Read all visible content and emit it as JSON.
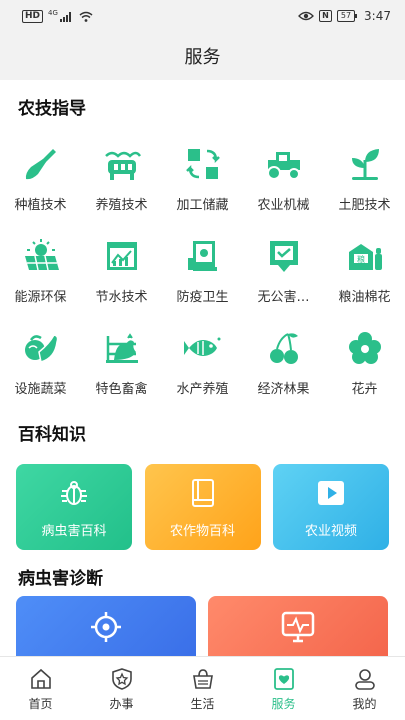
{
  "status_bar": {
    "hd": "HD",
    "network": "4G",
    "battery": "57",
    "time": "3:47"
  },
  "header": {
    "title": "服务"
  },
  "sections": {
    "tech": {
      "title": "农技指导"
    },
    "wiki": {
      "title": "百科知识"
    },
    "diagnosis": {
      "title": "病虫害诊断"
    }
  },
  "tech_items": [
    {
      "label": "种植技术",
      "icon": "shovel-sprout-icon"
    },
    {
      "label": "养殖技术",
      "icon": "livestock-icon"
    },
    {
      "label": "加工储藏",
      "icon": "processing-storage-icon"
    },
    {
      "label": "农业机械",
      "icon": "tractor-icon"
    },
    {
      "label": "土肥技术",
      "icon": "soil-sprout-icon"
    },
    {
      "label": "能源环保",
      "icon": "solar-panel-icon"
    },
    {
      "label": "节水技术",
      "icon": "water-chart-icon"
    },
    {
      "label": "防疫卫生",
      "icon": "epidemic-prevention-icon"
    },
    {
      "label": "无公害…",
      "icon": "pollution-free-icon"
    },
    {
      "label": "粮油棉花",
      "icon": "grain-barn-icon"
    },
    {
      "label": "设施蔬菜",
      "icon": "vegetables-icon"
    },
    {
      "label": "特色畜禽",
      "icon": "rooster-icon"
    },
    {
      "label": "水产养殖",
      "icon": "fish-icon"
    },
    {
      "label": "经济林果",
      "icon": "cherry-icon"
    },
    {
      "label": "花卉",
      "icon": "flower-icon"
    }
  ],
  "wiki_cards": [
    {
      "label": "病虫害百科",
      "icon": "bug-icon"
    },
    {
      "label": "农作物百科",
      "icon": "book-icon"
    },
    {
      "label": "农业视频",
      "icon": "play-video-icon"
    }
  ],
  "tabs": [
    {
      "label": "首页",
      "icon": "home-icon",
      "active": false
    },
    {
      "label": "办事",
      "icon": "shield-star-icon",
      "active": false
    },
    {
      "label": "生活",
      "icon": "basket-icon",
      "active": false
    },
    {
      "label": "服务",
      "icon": "heart-service-icon",
      "active": true
    },
    {
      "label": "我的",
      "icon": "user-icon",
      "active": false
    }
  ],
  "colors": {
    "accent": "#2bbf8a",
    "icon_green": "#2bbf8a"
  }
}
